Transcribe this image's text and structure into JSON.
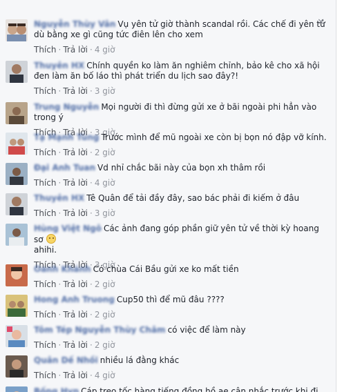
{
  "close_glyph": "✕",
  "meta": {
    "like": "Thích",
    "reply": "Trả lời",
    "sep": "·"
  },
  "comments": [
    {
      "name": "Nguyễn Thùy Vân",
      "text": "Vụ yên tử giờ thành scandal rồi. Các chế đi yên tử dù bằng xe gì cũng tức điên lên cho xem",
      "time": "4 giờ"
    },
    {
      "name": "Thuyên HX",
      "text": "Chính quyền ko làm ăn nghiêm chỉnh, bảo kê cho xã hội đen làm ăn bố láo thì phát triển du lịch sao đây?!",
      "time": "3 giờ"
    },
    {
      "name": "Trung Nguyễn",
      "text": "Mọi người đi thì đừng gửi xe ở bãi ngoài phi hẳn vào trong ý",
      "time": "3 giờ"
    },
    {
      "name": "Tạ Mạnh Tùng",
      "text": "Trước mình để mũ ngoài xe còn bị bọn nó đập vỡ kính.",
      "time": "2 giờ"
    },
    {
      "name": "Đại Anh Tuan",
      "text": "Vd nhỉ chắc bãi này của bọn xh thâm rồi",
      "time": "4 giờ"
    },
    {
      "name": "Thuyên HX",
      "text": "Tê Quân để tải đầy đây, sao bác phải đi kiếm ở đâu",
      "time": "3 giờ"
    },
    {
      "name": "Hùng Việt Ngô",
      "text": "Các ảnh đang góp phần giữ yên tử về thời kỳ hoang sơ",
      "text2": "ahihi.",
      "time": "3 giờ"
    },
    {
      "name": "Oanh Khánh",
      "text": "Có chùa Cái Bầu gửi xe ko mất tiền",
      "time": "2 giờ"
    },
    {
      "name": "Hong Anh Truong",
      "text": "Cup50 thì để mũ đâu ????",
      "time": "2 giờ"
    },
    {
      "name": "Tôm Tép Nguyễn Thùy Châm",
      "text": "có việc để làm này",
      "time": "2 giờ"
    },
    {
      "name": "Quân Dế Nhồi",
      "text": "nhiều lá đằng khác",
      "time": "4 giờ"
    },
    {
      "name": "Bống Hyn",
      "text": "Cáp treo tốc hàng tiếng đồng hồ ae cân nhắc trước khi đi",
      "time": ""
    }
  ],
  "colors": {
    "link": "#365899",
    "meta": "#90949c",
    "background": "#f6f7f9"
  }
}
